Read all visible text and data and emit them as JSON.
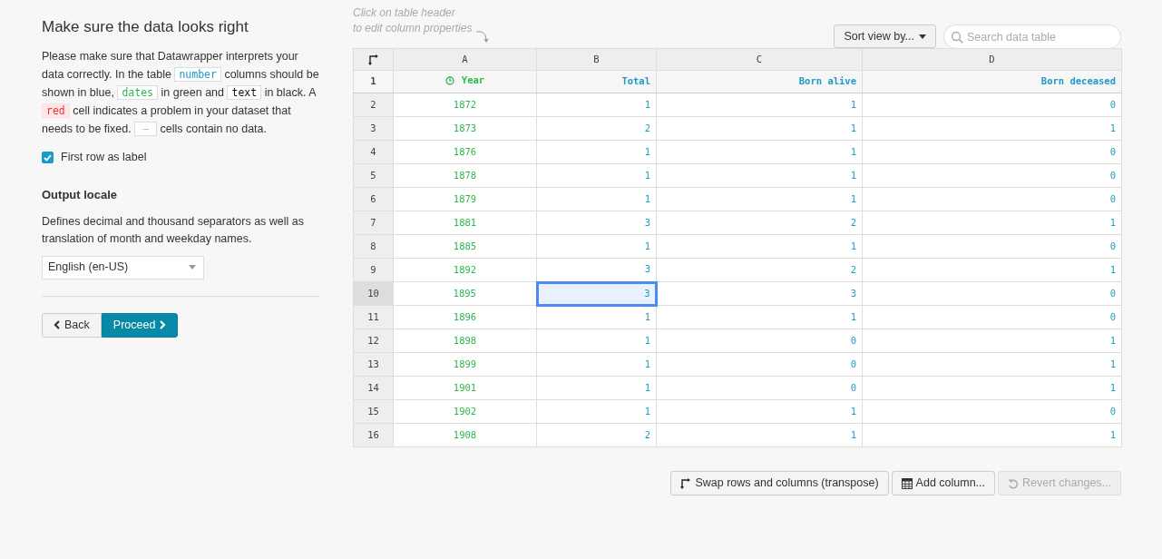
{
  "sidebar": {
    "title": "Make sure the data looks right",
    "intro": [
      {
        "kind": "text",
        "text": "Please make sure that Datawrapper interprets your data correctly. In the table "
      },
      {
        "kind": "number_tag",
        "text": "number"
      },
      {
        "kind": "text",
        "text": " columns should be shown in blue, "
      },
      {
        "kind": "date_tag",
        "text": "dates"
      },
      {
        "kind": "text",
        "text": " in green and "
      },
      {
        "kind": "text_tag",
        "text": "text"
      },
      {
        "kind": "text",
        "text": " in black. A "
      },
      {
        "kind": "error_tag",
        "text": "red"
      },
      {
        "kind": "text",
        "text": " cell indicates a problem in your dataset that needs to be fixed. "
      },
      {
        "kind": "empty_tag",
        "text": "—"
      },
      {
        "kind": "text",
        "text": " cells contain no data."
      }
    ],
    "first_row_checkbox": {
      "label": "First row as label",
      "checked": true
    },
    "locale": {
      "heading": "Output locale",
      "description": "Defines decimal and thousand separators as well as translation of month and weekday names.",
      "value": "English (en-US)"
    },
    "back_button": "Back",
    "proceed_button": "Proceed"
  },
  "hint": [
    "Click on table header",
    "to edit column properties"
  ],
  "sort_button": "Sort view by...",
  "search": {
    "placeholder": "Search data table"
  },
  "table": {
    "columns": [
      {
        "letter": "A",
        "header": "Year",
        "kind": "date"
      },
      {
        "letter": "B",
        "header": "Total",
        "kind": "number"
      },
      {
        "letter": "C",
        "header": "Born alive",
        "kind": "number"
      },
      {
        "letter": "D",
        "header": "Born deceased",
        "kind": "number"
      }
    ],
    "header_row_number": "1",
    "rows": [
      {
        "number": "2",
        "selected": false,
        "cells": [
          {
            "text": "1872",
            "selected": false
          },
          {
            "text": "1",
            "selected": false
          },
          {
            "text": "1",
            "selected": false
          },
          {
            "text": "0",
            "selected": false
          }
        ]
      },
      {
        "number": "3",
        "selected": false,
        "cells": [
          {
            "text": "1873",
            "selected": false
          },
          {
            "text": "2",
            "selected": false
          },
          {
            "text": "1",
            "selected": false
          },
          {
            "text": "1",
            "selected": false
          }
        ]
      },
      {
        "number": "4",
        "selected": false,
        "cells": [
          {
            "text": "1876",
            "selected": false
          },
          {
            "text": "1",
            "selected": false
          },
          {
            "text": "1",
            "selected": false
          },
          {
            "text": "0",
            "selected": false
          }
        ]
      },
      {
        "number": "5",
        "selected": false,
        "cells": [
          {
            "text": "1878",
            "selected": false
          },
          {
            "text": "1",
            "selected": false
          },
          {
            "text": "1",
            "selected": false
          },
          {
            "text": "0",
            "selected": false
          }
        ]
      },
      {
        "number": "6",
        "selected": false,
        "cells": [
          {
            "text": "1879",
            "selected": false
          },
          {
            "text": "1",
            "selected": false
          },
          {
            "text": "1",
            "selected": false
          },
          {
            "text": "0",
            "selected": false
          }
        ]
      },
      {
        "number": "7",
        "selected": false,
        "cells": [
          {
            "text": "1881",
            "selected": false
          },
          {
            "text": "3",
            "selected": false
          },
          {
            "text": "2",
            "selected": false
          },
          {
            "text": "1",
            "selected": false
          }
        ]
      },
      {
        "number": "8",
        "selected": false,
        "cells": [
          {
            "text": "1885",
            "selected": false
          },
          {
            "text": "1",
            "selected": false
          },
          {
            "text": "1",
            "selected": false
          },
          {
            "text": "0",
            "selected": false
          }
        ]
      },
      {
        "number": "9",
        "selected": false,
        "cells": [
          {
            "text": "1892",
            "selected": false
          },
          {
            "text": "3",
            "selected": false
          },
          {
            "text": "2",
            "selected": false
          },
          {
            "text": "1",
            "selected": false
          }
        ]
      },
      {
        "number": "10",
        "selected": true,
        "cells": [
          {
            "text": "1895",
            "selected": false
          },
          {
            "text": "3",
            "selected": true
          },
          {
            "text": "3",
            "selected": false
          },
          {
            "text": "0",
            "selected": false
          }
        ]
      },
      {
        "number": "11",
        "selected": false,
        "cells": [
          {
            "text": "1896",
            "selected": false
          },
          {
            "text": "1",
            "selected": false
          },
          {
            "text": "1",
            "selected": false
          },
          {
            "text": "0",
            "selected": false
          }
        ]
      },
      {
        "number": "12",
        "selected": false,
        "cells": [
          {
            "text": "1898",
            "selected": false
          },
          {
            "text": "1",
            "selected": false
          },
          {
            "text": "0",
            "selected": false
          },
          {
            "text": "1",
            "selected": false
          }
        ]
      },
      {
        "number": "13",
        "selected": false,
        "cells": [
          {
            "text": "1899",
            "selected": false
          },
          {
            "text": "1",
            "selected": false
          },
          {
            "text": "0",
            "selected": false
          },
          {
            "text": "1",
            "selected": false
          }
        ]
      },
      {
        "number": "14",
        "selected": false,
        "cells": [
          {
            "text": "1901",
            "selected": false
          },
          {
            "text": "1",
            "selected": false
          },
          {
            "text": "0",
            "selected": false
          },
          {
            "text": "1",
            "selected": false
          }
        ]
      },
      {
        "number": "15",
        "selected": false,
        "cells": [
          {
            "text": "1902",
            "selected": false
          },
          {
            "text": "1",
            "selected": false
          },
          {
            "text": "1",
            "selected": false
          },
          {
            "text": "0",
            "selected": false
          }
        ]
      },
      {
        "number": "16",
        "selected": false,
        "cells": [
          {
            "text": "1908",
            "selected": false
          },
          {
            "text": "2",
            "selected": false
          },
          {
            "text": "1",
            "selected": false
          },
          {
            "text": "1",
            "selected": false
          }
        ]
      }
    ]
  },
  "actions": [
    {
      "kind": "transpose",
      "label": "Swap rows and columns (transpose)",
      "disabled": false
    },
    {
      "kind": "add",
      "label": "Add column...",
      "disabled": false
    },
    {
      "kind": "revert",
      "label": "Revert changes...",
      "disabled": true
    }
  ]
}
